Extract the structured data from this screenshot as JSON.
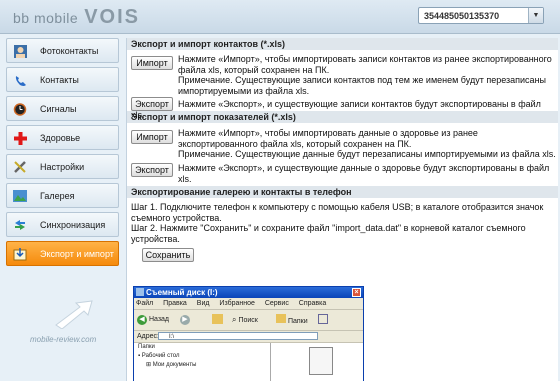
{
  "header": {
    "logo_main": "bb mobile",
    "logo_brand": "VOIS",
    "device_id": "354485050135370"
  },
  "sidebar": {
    "items": [
      {
        "label": "Фотоконтакты",
        "icon": "photo-contacts-icon",
        "active": false
      },
      {
        "label": "Контакты",
        "icon": "phone-icon",
        "active": false
      },
      {
        "label": "Сигналы",
        "icon": "alarm-clock-icon",
        "active": false
      },
      {
        "label": "Здоровье",
        "icon": "health-cross-icon",
        "active": false
      },
      {
        "label": "Настройки",
        "icon": "settings-tools-icon",
        "active": false
      },
      {
        "label": "Галерея",
        "icon": "gallery-icon",
        "active": false
      },
      {
        "label": "Синхронизация",
        "icon": "sync-icon",
        "active": false
      },
      {
        "label": "Экспорт и импорт",
        "icon": "export-import-icon",
        "active": true
      }
    ]
  },
  "watermark": "mobile-review.com",
  "contacts": {
    "title": "Экспорт и импорт контактов (*.xls)",
    "import_label": "Импорт",
    "import_desc_1": "Нажмите «Импорт», чтобы импортировать записи контактов из ранее экспортированного",
    "import_desc_2": "файла xls, который сохранен на ПК.",
    "import_desc_3": "Примечание. Существующие записи контактов под тем же именем будут перезаписаны",
    "import_desc_4": "импортируемыми из файла xls.",
    "export_label": "Экспорт",
    "export_desc_1": "Нажмите «Экспорт», и существующие записи контактов будут экспортированы в файл",
    "export_desc_2": "xls."
  },
  "health": {
    "title": "Экспорт и импорт показателей (*.xls)",
    "import_label": "Импорт",
    "import_desc_1": "Нажмите «Импорт», чтобы импортировать данные о здоровье из ранее",
    "import_desc_2": "экспортированного файла xls, который сохранен на ПК.",
    "import_desc_3": "Примечание. Существующие данные будут перезаписаны импортируемыми из файла xls.",
    "export_label": "Экспорт",
    "export_desc_1": "Нажмите «Экспорт», и существующие данные о здоровье будут экспортированы в файл",
    "export_desc_2": "xls."
  },
  "phone_export": {
    "title": "Экспортирование галерею и контакты в телефон",
    "step1_a": "Шаг 1. Подключите телефон к компьютеру с помощью кабеля USB; в каталоге отобразится значок",
    "step1_b": "съемного устройства.",
    "step2_a": "Шаг 2. Нажмите \"Сохранить\" и сохраните файл \"import_data.dat\" в корневой каталог съемного",
    "step2_b": "устройства.",
    "save_label": "Сохранить"
  },
  "explorer": {
    "title": "Съемный диск (I:)",
    "menu": [
      "Файл",
      "Правка",
      "Вид",
      "Избранное",
      "Сервис",
      "Справка"
    ],
    "back": "Назад",
    "search": "Поиск",
    "folders": "Папки",
    "address_label": "Адрес:",
    "address_value": "I:\\",
    "tree_header": "Папки",
    "tree_items": [
      "Рабочий стол",
      "Мои документы"
    ]
  }
}
